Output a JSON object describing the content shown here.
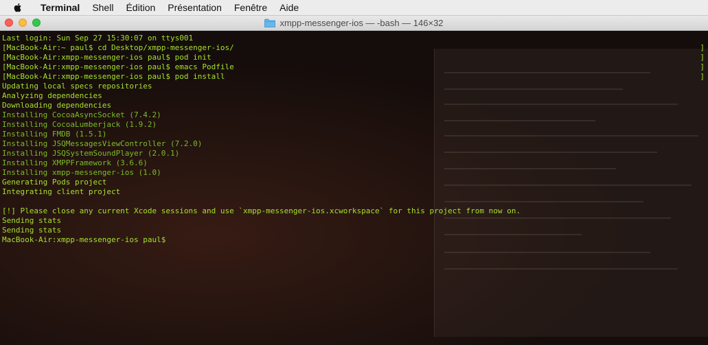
{
  "menubar": {
    "app": "Terminal",
    "items": [
      "Shell",
      "Édition",
      "Présentation",
      "Fenêtre",
      "Aide"
    ]
  },
  "window": {
    "title": "xmpp-messenger-ios — -bash — 146×32"
  },
  "terminal": {
    "lines": [
      "Last login: Sun Sep 27 15:30:07 on ttys001",
      "[MacBook-Air:~ paul$ cd Desktop/xmpp-messenger-ios/",
      "[MacBook-Air:xmpp-messenger-ios paul$ pod init",
      "[MacBook-Air:xmpp-messenger-ios paul$ emacs Podfile",
      "[MacBook-Air:xmpp-messenger-ios paul$ pod install",
      "Updating local specs repositories",
      "Analyzing dependencies",
      "Downloading dependencies",
      "Installing CocoaAsyncSocket (7.4.2)",
      "Installing CocoaLumberjack (1.9.2)",
      "Installing FMDB (1.5.1)",
      "Installing JSQMessagesViewController (7.2.0)",
      "Installing JSQSystemSoundPlayer (2.0.1)",
      "Installing XMPPFramework (3.6.6)",
      "Installing xmpp-messenger-ios (1.0)",
      "Generating Pods project",
      "Integrating client project",
      "",
      "[!] Please close any current Xcode sessions and use `xmpp-messenger-ios.xcworkspace` for this project from now on.",
      "Sending stats",
      "Sending stats",
      "MacBook-Air:xmpp-messenger-ios paul$"
    ],
    "bracket": "]",
    "colors": {
      "text": "#a6e22e",
      "installing": "#7dbb2a"
    }
  }
}
